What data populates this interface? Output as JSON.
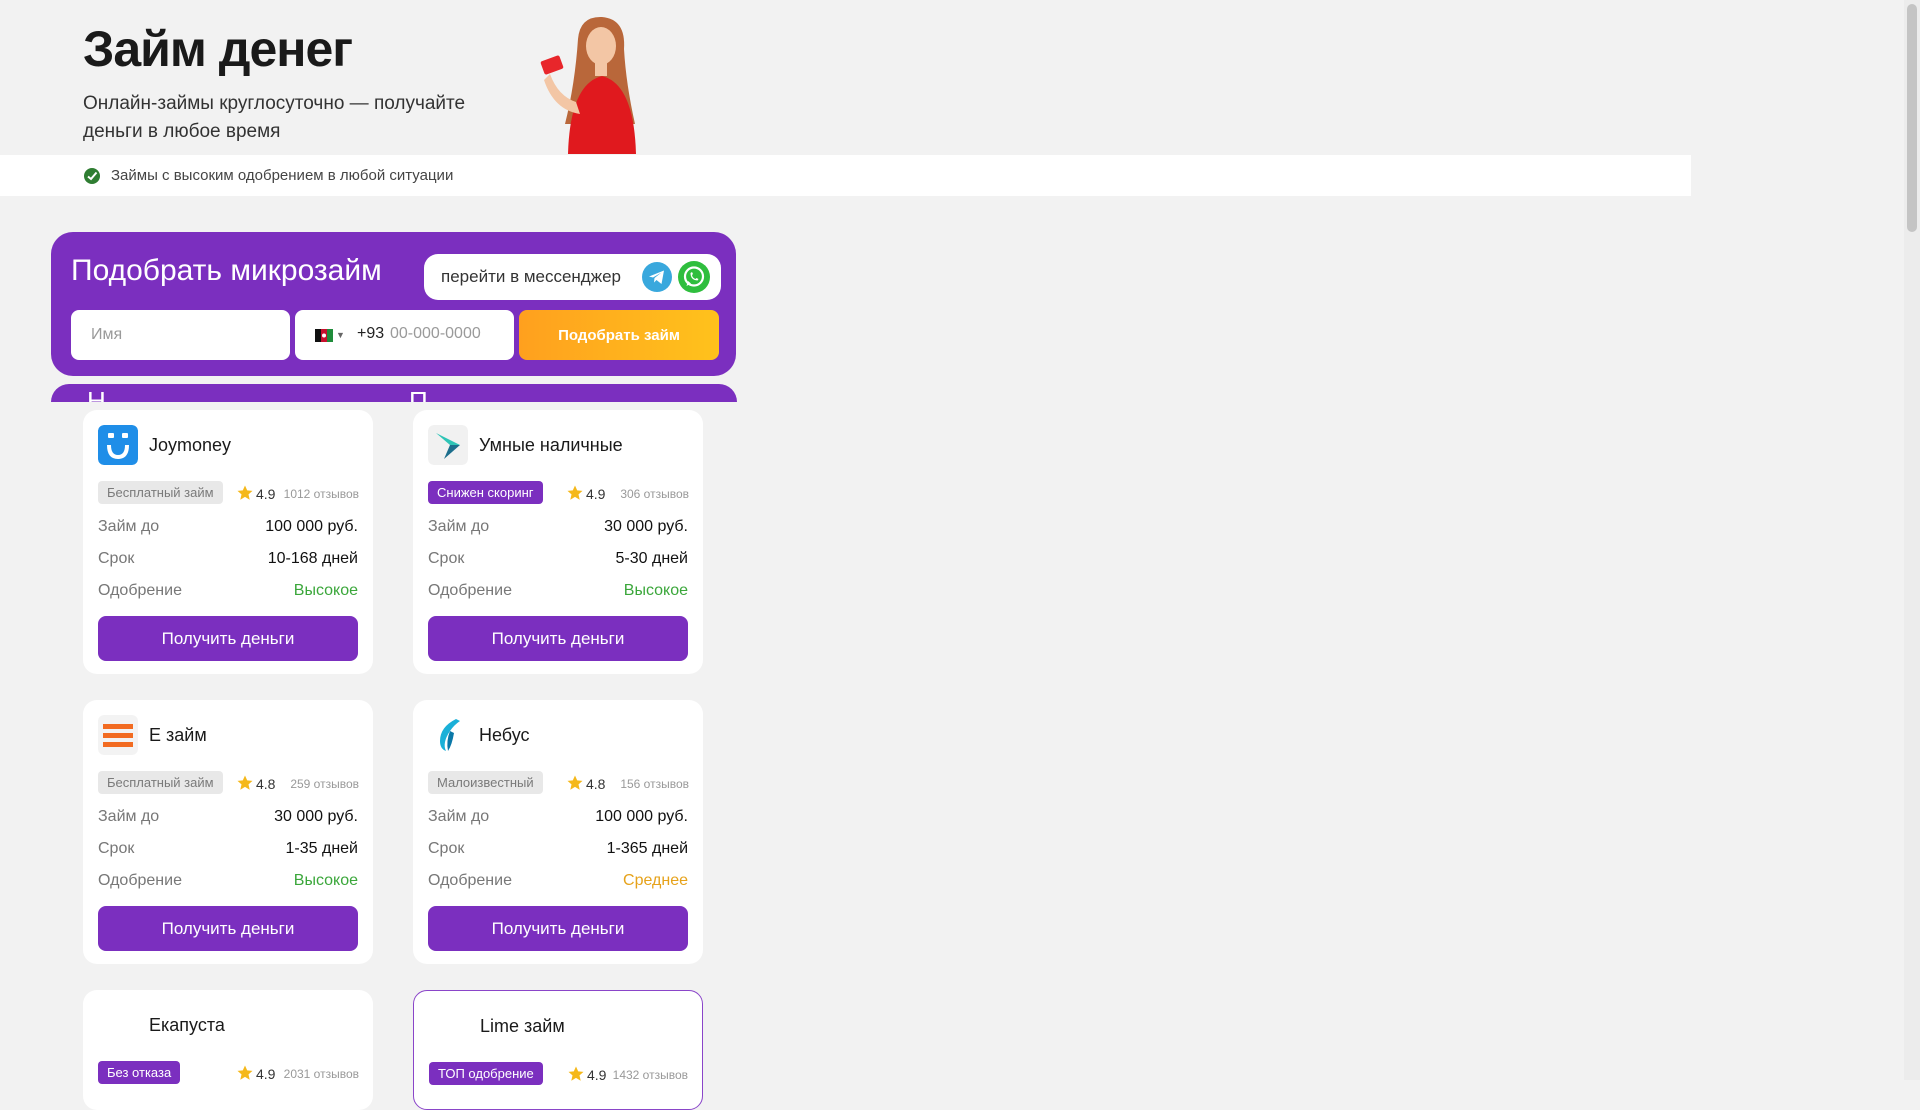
{
  "header": {
    "title": "Займ денег",
    "subtitle": "Онлайн-займы круглосуточно — получайте деньги в любое время"
  },
  "info_bar": {
    "text": "Займы с высоким одобрением в любой ситуации"
  },
  "picker": {
    "title": "Подобрать микрозайм",
    "messenger_label": "перейти в мессенджер",
    "name_placeholder": "Имя",
    "phone_code": "+93",
    "phone_placeholder": "00-000-0000",
    "submit_label": "Подобрать займ"
  },
  "colors": {
    "accent": "#7b2fbf",
    "button_orange": "#ffa01e",
    "green": "#3ba73b",
    "amber": "#e6a21a"
  },
  "offers": [
    {
      "name": "Joymoney",
      "badge": "Бесплатный займ",
      "rating": "4.9",
      "reviews": "1012 отзывов",
      "amount_label": "Займ до",
      "amount": "100 000 руб.",
      "term_label": "Срок",
      "term": "10-168 дней",
      "approval_label": "Одобрение",
      "approval": "Высокое",
      "button": "Получить деньги"
    },
    {
      "name": "Умные наличные",
      "badge": "Снижен скоринг",
      "rating": "4.9",
      "reviews": "306 отзывов",
      "amount_label": "Займ до",
      "amount": "30 000 руб.",
      "term_label": "Срок",
      "term": "5-30 дней",
      "approval_label": "Одобрение",
      "approval": "Высокое",
      "button": "Получить деньги"
    },
    {
      "name": "Е займ",
      "badge": "Бесплатный займ",
      "rating": "4.8",
      "reviews": "259 отзывов",
      "amount_label": "Займ до",
      "amount": "30 000 руб.",
      "term_label": "Срок",
      "term": "1-35 дней",
      "approval_label": "Одобрение",
      "approval": "Высокое",
      "button": "Получить деньги"
    },
    {
      "name": "Небус",
      "badge": "Малоизвестный",
      "rating": "4.8",
      "reviews": "156 отзывов",
      "amount_label": "Займ до",
      "amount": "100 000 руб.",
      "term_label": "Срок",
      "term": "1-365 дней",
      "approval_label": "Одобрение",
      "approval": "Среднее",
      "button": "Получить деньги"
    },
    {
      "name": "Екапуста",
      "badge": "Без отказа",
      "rating": "4.9",
      "reviews": "2031 отзывов"
    },
    {
      "name": "Lime займ",
      "badge": "ТОП одобрение",
      "rating": "4.9",
      "reviews": "1432 отзывов"
    }
  ]
}
